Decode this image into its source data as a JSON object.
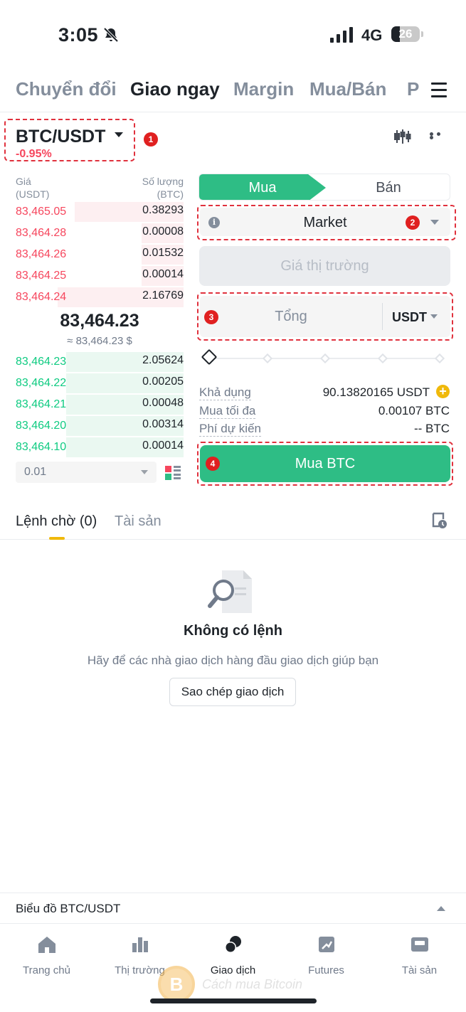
{
  "status_bar": {
    "time": "3:05",
    "network": "4G",
    "battery": "26"
  },
  "top_tabs": [
    {
      "label": "Chuyển đổi",
      "active": false
    },
    {
      "label": "Giao ngay",
      "active": true
    },
    {
      "label": "Margin",
      "active": false
    },
    {
      "label": "Mua/Bán",
      "active": false
    },
    {
      "label": "P",
      "active": false
    }
  ],
  "pair": {
    "name": "BTC/USDT",
    "change": "-0.95%"
  },
  "annotations": [
    "1",
    "2",
    "3",
    "4"
  ],
  "order_book": {
    "price_header": "Giá",
    "price_unit": "(USDT)",
    "qty_header": "Số lượng",
    "qty_unit": "(BTC)",
    "asks": [
      {
        "price": "83,465.05",
        "qty": "0.38293",
        "depth": 0.65
      },
      {
        "price": "83,464.28",
        "qty": "0.00008",
        "depth": 0.25
      },
      {
        "price": "83,464.26",
        "qty": "0.01532",
        "depth": 0.25
      },
      {
        "price": "83,464.25",
        "qty": "0.00014",
        "depth": 0.25
      },
      {
        "price": "83,464.24",
        "qty": "2.16769",
        "depth": 0.75
      }
    ],
    "last_price": "83,464.23",
    "last_price_usd": "≈ 83,464.23 $",
    "bids": [
      {
        "price": "83,464.23",
        "qty": "2.05624",
        "depth": 0.7
      },
      {
        "price": "83,464.22",
        "qty": "0.00205",
        "depth": 0.7
      },
      {
        "price": "83,464.21",
        "qty": "0.00048",
        "depth": 0.7
      },
      {
        "price": "83,464.20",
        "qty": "0.00314",
        "depth": 0.7
      },
      {
        "price": "83,464.10",
        "qty": "0.00014",
        "depth": 0.7
      }
    ],
    "precision": "0.01"
  },
  "order_form": {
    "buy_label": "Mua",
    "sell_label": "Bán",
    "order_type": "Market",
    "info_glyph": "i",
    "market_price_placeholder": "Giá thị trường",
    "total_placeholder": "Tổng",
    "total_unit": "USDT",
    "slider_percent": 0,
    "available_label": "Khả dụng",
    "available_value": "90.13820165 USDT",
    "max_buy_label": "Mua tối đa",
    "max_buy_value": "0.00107 BTC",
    "fee_label": "Phí dự kiến",
    "fee_value": "-- BTC",
    "submit_label": "Mua BTC"
  },
  "orders": {
    "tabs": [
      {
        "label": "Lệnh chờ (0)",
        "active": true
      },
      {
        "label": "Tài sản",
        "active": false
      }
    ],
    "empty_title": "Không có lệnh",
    "empty_subtitle": "Hãy để các nhà giao dịch hàng đầu giao dịch giúp bạn",
    "copy_button": "Sao chép giao dịch"
  },
  "chart_bar": {
    "label": "Biểu đồ BTC/USDT"
  },
  "bottom_nav": [
    {
      "label": "Trang chủ",
      "icon": "home-icon",
      "active": false
    },
    {
      "label": "Thị trường",
      "icon": "markets-icon",
      "active": false
    },
    {
      "label": "Giao dịch",
      "icon": "trade-icon",
      "active": true
    },
    {
      "label": "Futures",
      "icon": "futures-icon",
      "active": false
    },
    {
      "label": "Tài sản",
      "icon": "wallet-icon",
      "active": false
    }
  ],
  "watermark": {
    "glyph": "B",
    "text": "Cách mua Bitcoin"
  },
  "colors": {
    "buy": "#2ebd85",
    "sell": "#f6465d",
    "accent": "#f0b90b",
    "annotation": "#e02020"
  }
}
